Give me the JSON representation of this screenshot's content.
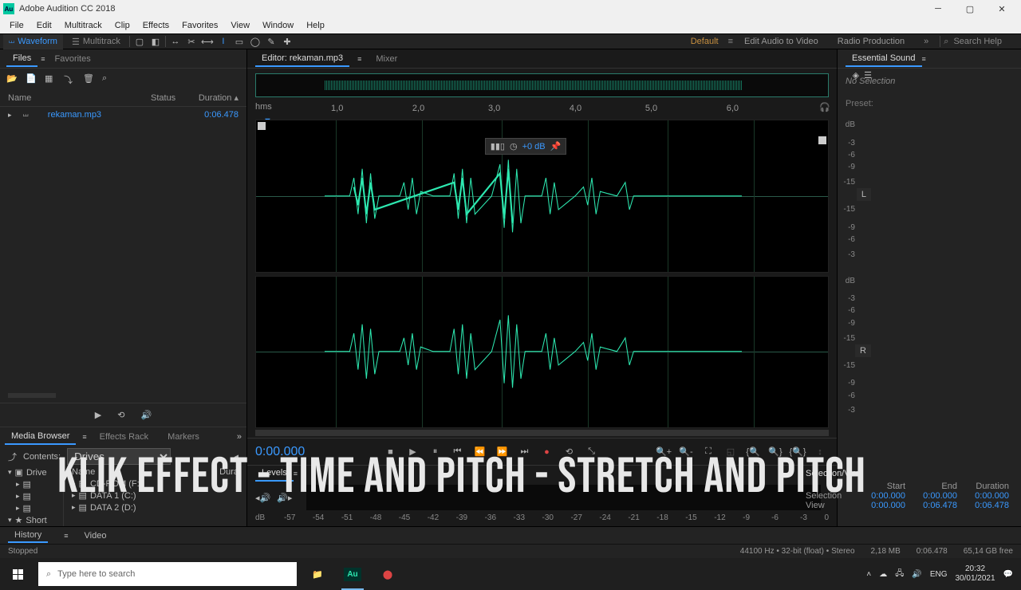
{
  "title_bar": {
    "app": "Adobe Audition CC 2018"
  },
  "menu": [
    "File",
    "Edit",
    "Multitrack",
    "Clip",
    "Effects",
    "Favorites",
    "View",
    "Window",
    "Help"
  ],
  "toolbar": {
    "waveform": "Waveform",
    "multitrack": "Multitrack",
    "workspaces": {
      "default": "Default",
      "edit_video": "Edit Audio to Video",
      "radio": "Radio Production"
    },
    "search_placeholder": "Search Help"
  },
  "files_panel": {
    "tabs": {
      "files": "Files",
      "favorites": "Favorites"
    },
    "cols": {
      "name": "Name",
      "status": "Status",
      "duration": "Duration"
    },
    "items": [
      {
        "name": "rekaman.mp3",
        "duration": "0:06.478"
      }
    ]
  },
  "media_browser": {
    "tabs": {
      "mb": "Media Browser",
      "er": "Effects Rack",
      "mk": "Markers"
    },
    "contents_label": "Contents:",
    "contents_value": "Drives",
    "left_header": "Drive",
    "right_header_name": "Name",
    "right_header_dur": "Dura",
    "left_items": [
      "Drive",
      "Short"
    ],
    "right_items": [
      "CD-ROM (F:)",
      "DATA 1 (C:)",
      "DATA 2 (D:)"
    ]
  },
  "editor": {
    "tab_label": "Editor: rekaman.mp3",
    "mixer": "Mixer",
    "ruler_label": "hms",
    "ticks": [
      "1,0",
      "2,0",
      "3,0",
      "4,0",
      "5,0",
      "6,0"
    ],
    "db_label": "dB",
    "db_marks": [
      "-3",
      "-6",
      "-9",
      "-15",
      "-15",
      "-9",
      "-6",
      "-3"
    ],
    "ch_left": "L",
    "ch_right": "R",
    "hud_db": "+0 dB",
    "timecode": "0:00.000"
  },
  "levels": {
    "label": "Levels",
    "marks": [
      "dB",
      "-57",
      "-54",
      "-51",
      "-48",
      "-45",
      "-42",
      "-39",
      "-36",
      "-33",
      "-30",
      "-27",
      "-24",
      "-21",
      "-18",
      "-15",
      "-12",
      "-9",
      "-6",
      "-3",
      "0"
    ]
  },
  "selection": {
    "title": "Selection/View",
    "cols": [
      "Start",
      "End",
      "Duration"
    ],
    "rows": [
      {
        "label": "Selection",
        "start": "0:00.000",
        "end": "0:00.000",
        "dur": "0:00.000"
      },
      {
        "label": "View",
        "start": "0:00.000",
        "end": "0:06.478",
        "dur": "0:06.478"
      }
    ]
  },
  "essential": {
    "title": "Essential Sound",
    "no_sel": "No Selection",
    "preset_label": "Preset:"
  },
  "history": {
    "history": "History",
    "video": "Video"
  },
  "status": {
    "stopped": "Stopped",
    "format": "44100 Hz • 32-bit (float) • Stereo",
    "size": "2,18 MB",
    "dur": "0:06.478",
    "free": "65,14 GB free"
  },
  "taskbar": {
    "search_placeholder": "Type here to search",
    "lang": "ENG",
    "time": "20:32",
    "date": "30/01/2021"
  },
  "overlay": "Klik Effect - Time and Pitch - Stretch and Pitch"
}
